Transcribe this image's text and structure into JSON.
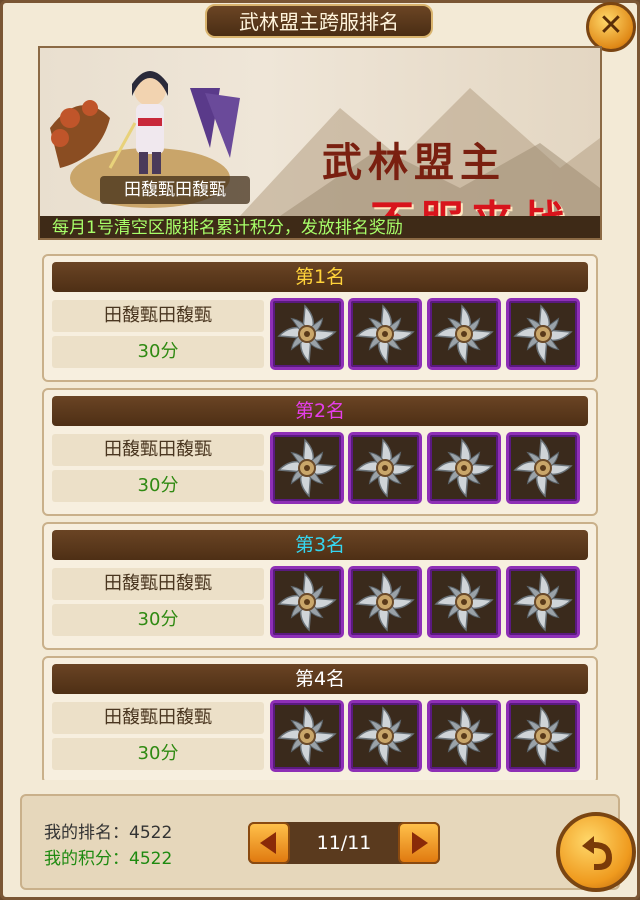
{
  "header": {
    "title": "武林盟主跨服排名",
    "close_icon": "close-icon"
  },
  "banner": {
    "character_name": "田馥甄田馥甄",
    "slogan_line1": "武林盟主",
    "slogan_line2": "不服来战",
    "notice": "每月1号清空区服排名累计积分，发放排名奖励"
  },
  "rankings": [
    {
      "label": "第1名",
      "player": "田馥甄田馥甄",
      "score": "30分",
      "color": "#ffd33a",
      "rewards": [
        "shuriken-icon",
        "shuriken-icon",
        "shuriken-icon",
        "shuriken-icon"
      ]
    },
    {
      "label": "第2名",
      "player": "田馥甄田馥甄",
      "score": "30分",
      "color": "#e43ee8",
      "rewards": [
        "shuriken-icon",
        "shuriken-icon",
        "shuriken-icon",
        "shuriken-icon"
      ]
    },
    {
      "label": "第3名",
      "player": "田馥甄田馥甄",
      "score": "30分",
      "color": "#35d6f0",
      "rewards": [
        "shuriken-icon",
        "shuriken-icon",
        "shuriken-icon",
        "shuriken-icon"
      ]
    },
    {
      "label": "第4名",
      "player": "田馥甄田馥甄",
      "score": "30分",
      "color": "#ffffff",
      "rewards": [
        "shuriken-icon",
        "shuriken-icon",
        "shuriken-icon",
        "shuriken-icon"
      ]
    }
  ],
  "footer": {
    "my_rank": "我的排名：4522",
    "my_score": "我的积分：4522",
    "page": "11/11"
  }
}
